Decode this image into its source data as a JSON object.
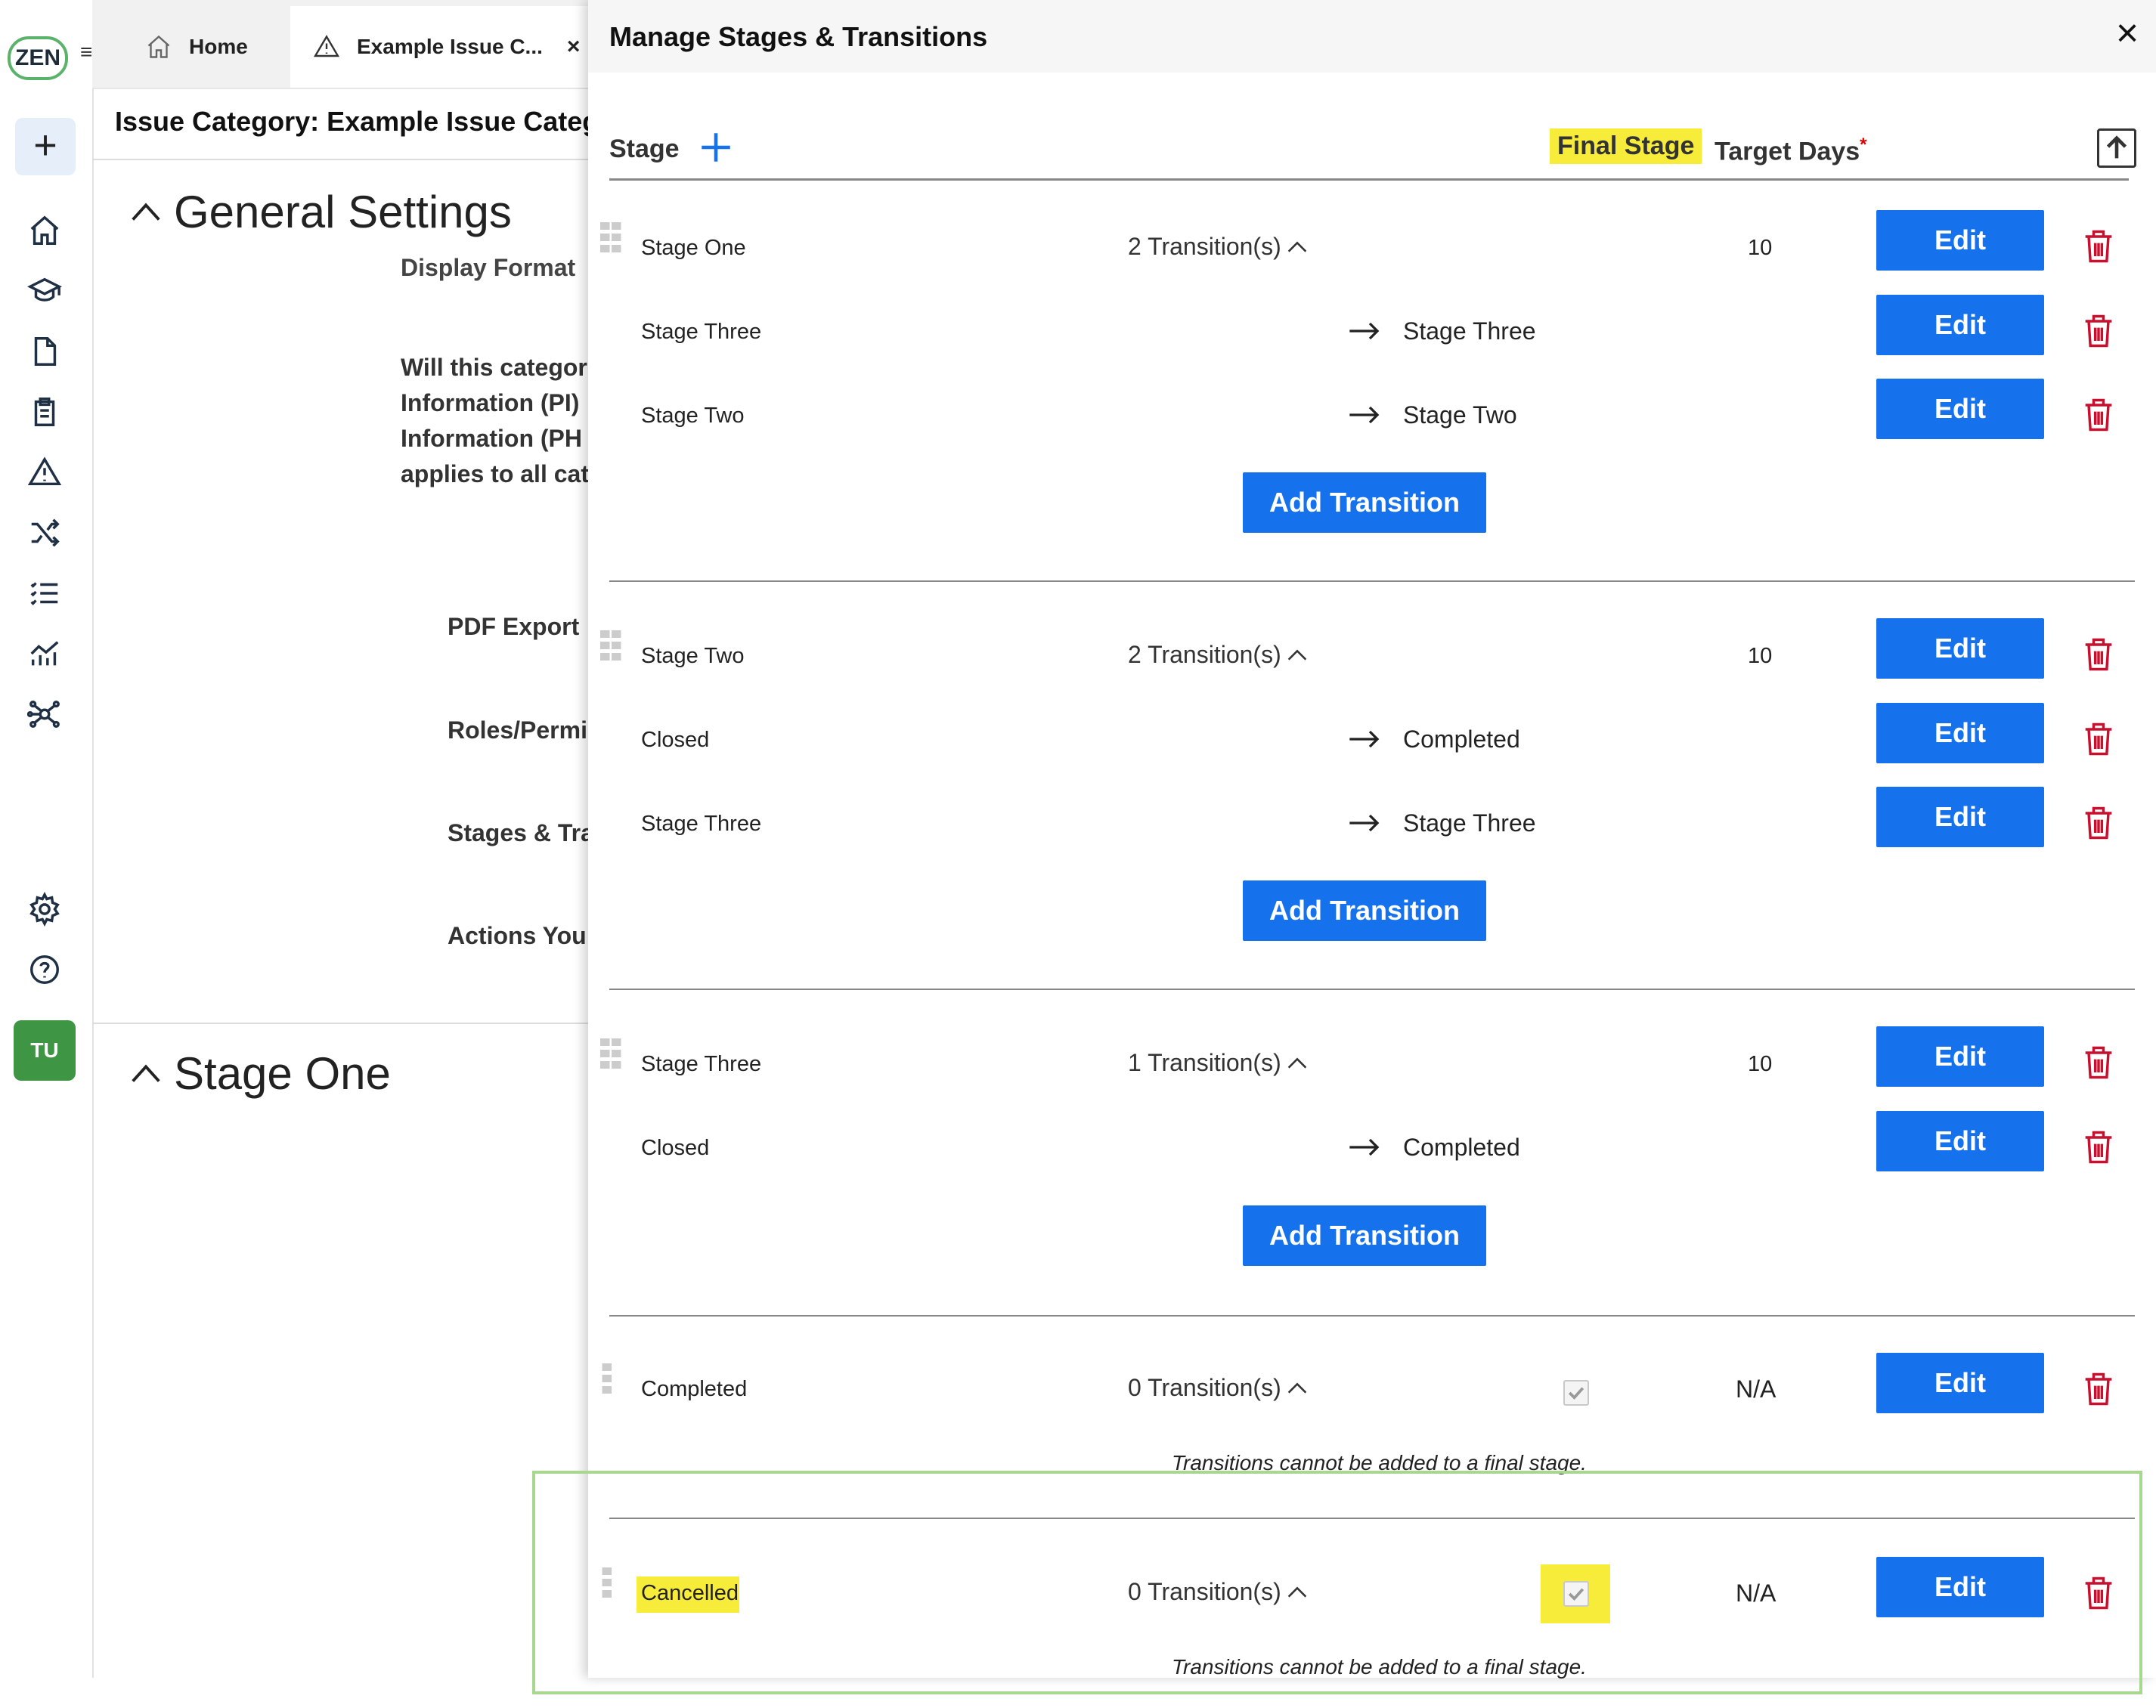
{
  "rail": {
    "logo": "ZEN",
    "avatar": "TU",
    "icons": [
      "menu-icon",
      "plus-icon",
      "home-icon",
      "graduation-cap-icon",
      "document-icon",
      "clipboard-icon",
      "warning-icon",
      "shuffle-icon",
      "list-icon",
      "analytics-icon",
      "network-icon",
      "gear-icon",
      "help-icon"
    ]
  },
  "tabs": [
    {
      "label": "Home",
      "icon": "home-icon"
    },
    {
      "label": "Example Issue C...",
      "icon": "warning-icon",
      "close": "×"
    }
  ],
  "background": {
    "title": "Issue Category: Example Issue Category",
    "general_settings": "General Settings",
    "display_format": "Display Format",
    "pi_question": "Will this categor\nInformation (PI)\nInformation (PH\napplies to all cat",
    "pdf_export": "PDF Export",
    "roles": "Roles/Permi",
    "stages": "Stages & Tra",
    "actions": "Actions You",
    "stage_one": "Stage One"
  },
  "modal": {
    "title": "Manage Stages & Transitions",
    "close": "×",
    "columns": {
      "stage": "Stage",
      "final_stage": "Final Stage",
      "target_days": "Target Days",
      "required_mark": "*"
    },
    "edit_label": "Edit",
    "add_transition_label": "Add Transition",
    "final_note": "Transitions cannot be added to a final stage.",
    "stages": [
      {
        "name": "Stage One",
        "transitions_label": "2 Transition(s)",
        "target_days": "10",
        "transitions": [
          {
            "from": "Stage Three",
            "to": "Stage Three"
          },
          {
            "from": "Stage Two",
            "to": "Stage Two"
          }
        ]
      },
      {
        "name": "Stage Two",
        "transitions_label": "2 Transition(s)",
        "target_days": "10",
        "transitions": [
          {
            "from": "Closed",
            "to": "Completed"
          },
          {
            "from": "Stage Three",
            "to": "Stage Three"
          }
        ]
      },
      {
        "name": "Stage Three",
        "transitions_label": "1 Transition(s)",
        "target_days": "10",
        "transitions": [
          {
            "from": "Closed",
            "to": "Completed"
          }
        ]
      },
      {
        "name": "Completed",
        "transitions_label": "0 Transition(s)",
        "target_days": "N/A",
        "final": true
      },
      {
        "name": "Cancelled",
        "transitions_label": "0 Transition(s)",
        "target_days": "N/A",
        "final": true
      }
    ]
  },
  "colors": {
    "primary": "#1672ec",
    "highlight": "#f8ec3a",
    "delete": "#c8102e",
    "avatar": "#3e9645",
    "annotation": "#a8d890"
  }
}
